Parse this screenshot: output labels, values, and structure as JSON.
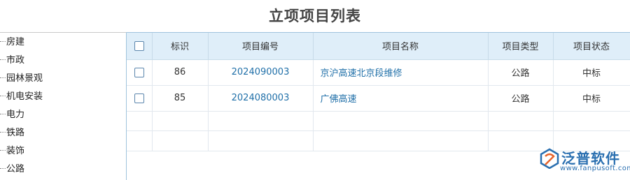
{
  "page": {
    "title": "立项项目列表"
  },
  "sidebar": {
    "items": [
      {
        "label": "房建"
      },
      {
        "label": "市政"
      },
      {
        "label": "园林景观"
      },
      {
        "label": "机电安装"
      },
      {
        "label": "电力"
      },
      {
        "label": "铁路"
      },
      {
        "label": "装饰"
      },
      {
        "label": "公路"
      }
    ]
  },
  "table": {
    "columns": [
      "",
      "标识",
      "项目编号",
      "项目名称",
      "项目类型",
      "项目状态"
    ],
    "rows": [
      {
        "id": "86",
        "code": "2024090003",
        "name": "京沪高速北京段维修",
        "type": "公路",
        "status": "中标"
      },
      {
        "id": "85",
        "code": "2024080003",
        "name": "广佛高速",
        "type": "公路",
        "status": "中标"
      }
    ]
  },
  "watermark": {
    "brand": "泛普软件",
    "url": "www.fanpusoft.com",
    "brand_color": "#2a6fb0",
    "accent_color": "#e8642c"
  }
}
